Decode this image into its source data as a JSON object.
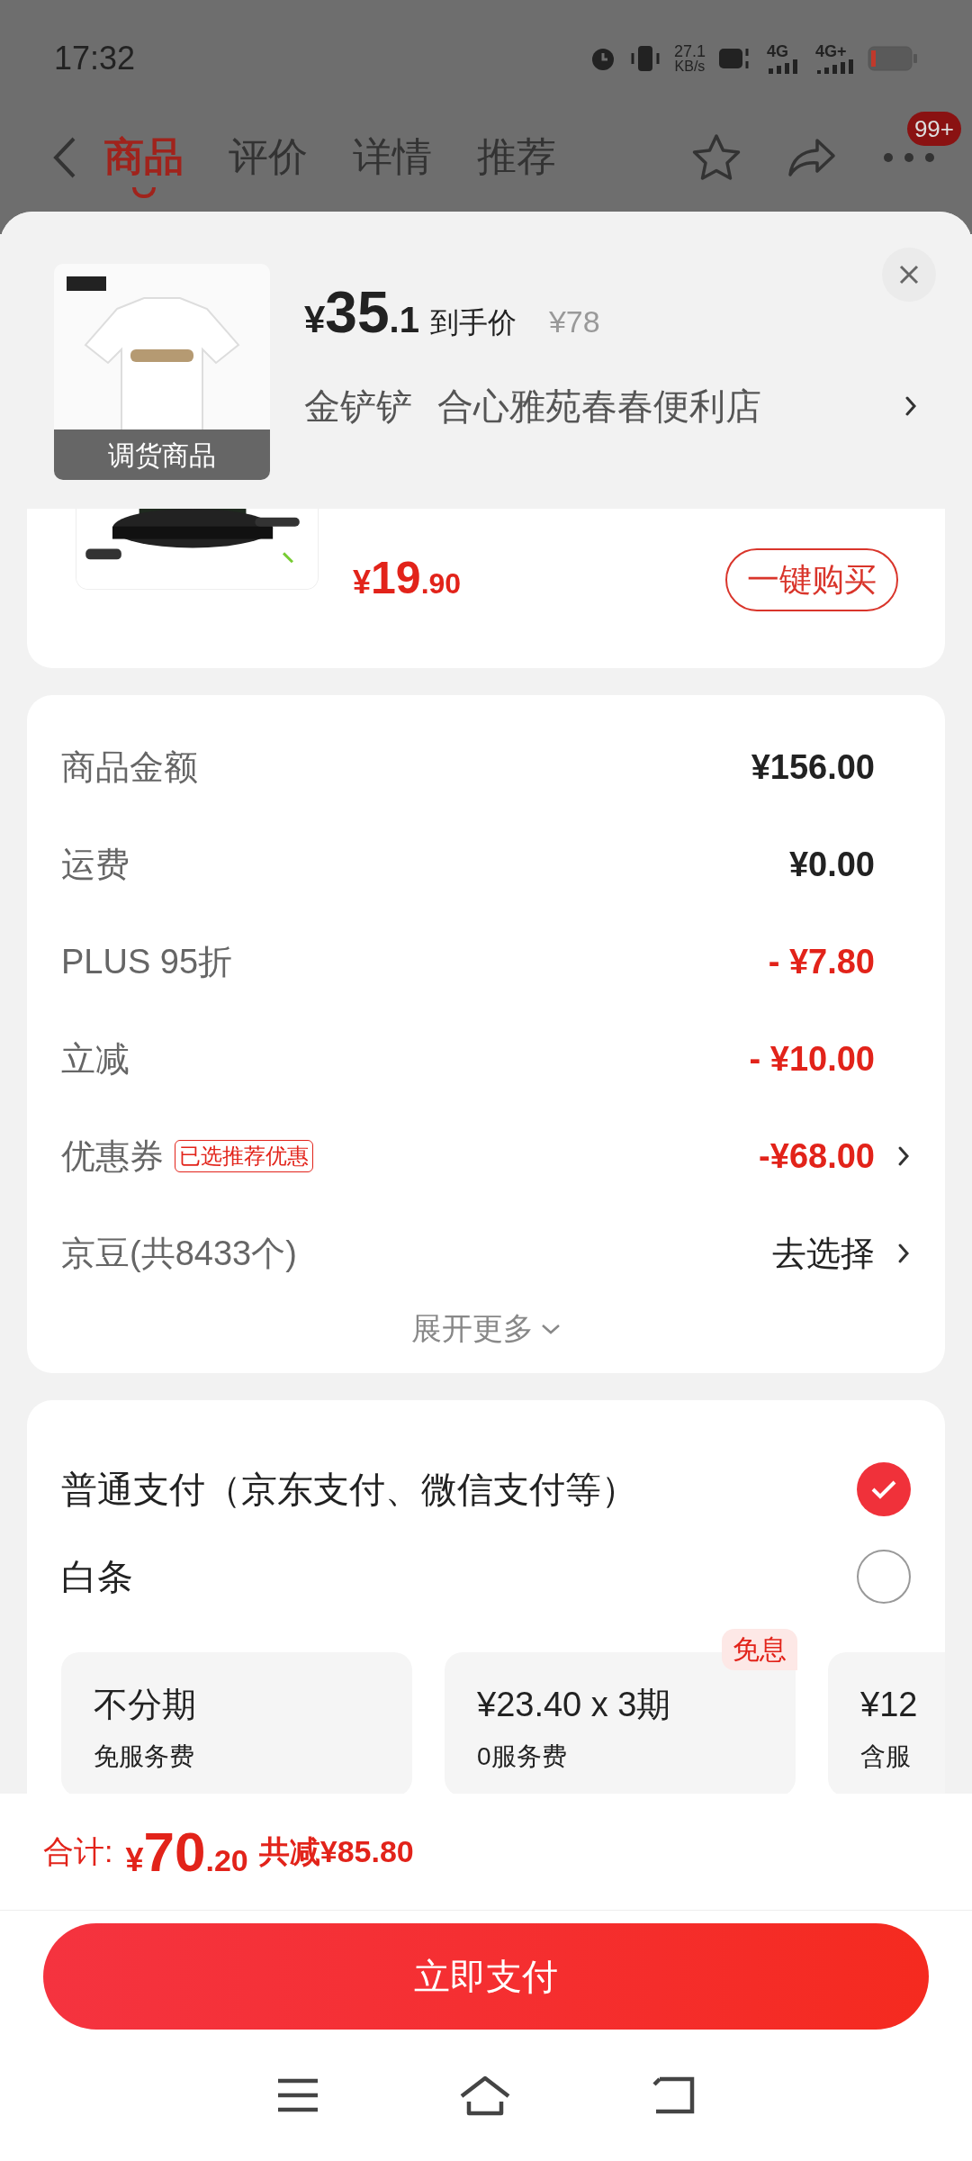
{
  "status_bar": {
    "time": "17:32",
    "speed": "27.1",
    "speed_unit": "KB/s",
    "signal_1": "4G",
    "signal_2": "4G+"
  },
  "nav": {
    "tabs": [
      {
        "label": "商品",
        "selected": true
      },
      {
        "label": "评价",
        "selected": false
      },
      {
        "label": "详情",
        "selected": false
      },
      {
        "label": "推荐",
        "selected": false
      }
    ],
    "badge": "99+"
  },
  "product": {
    "image_caption": "调货商品",
    "price_symbol": "¥",
    "price_int": "35",
    "price_dec": ".1",
    "price_label": "到手价",
    "original_price": "¥78",
    "sku": "金铲铲",
    "store": "合心雅苑春春便利店"
  },
  "addon": {
    "price_symbol": "¥",
    "price_int": "19",
    "price_dec": ".90",
    "button": "一键购买"
  },
  "summary": {
    "rows": [
      {
        "label": "商品金额",
        "value": "¥156.00",
        "kind": "plain"
      },
      {
        "label": "运费",
        "value": "¥0.00",
        "kind": "plain"
      },
      {
        "label": "PLUS 95折",
        "value": "- ¥7.80",
        "kind": "discount"
      },
      {
        "label": "立减",
        "value": "- ¥10.00",
        "kind": "discount"
      },
      {
        "label": "优惠券",
        "tag": "已选推荐优惠",
        "value": "-¥68.00",
        "kind": "discount_link"
      },
      {
        "label": "京豆(共8433个)",
        "value": "去选择",
        "kind": "link"
      }
    ],
    "expand": "展开更多"
  },
  "payment": {
    "methods": [
      {
        "label": "普通支付（京东支付、微信支付等）",
        "selected": true
      },
      {
        "label": "白条",
        "selected": false
      }
    ],
    "plans": [
      {
        "title": "不分期",
        "subtitle": "免服务费"
      },
      {
        "title": "¥23.40 x 3期",
        "subtitle": "0服务费",
        "badge": "免息"
      },
      {
        "title": "¥12",
        "subtitle": "含服"
      }
    ]
  },
  "footer": {
    "total_label": "合计:",
    "total_symbol": "¥",
    "total_int": "70",
    "total_dec": ".20",
    "saved": "共减¥85.80",
    "pay_button": "立即支付"
  }
}
